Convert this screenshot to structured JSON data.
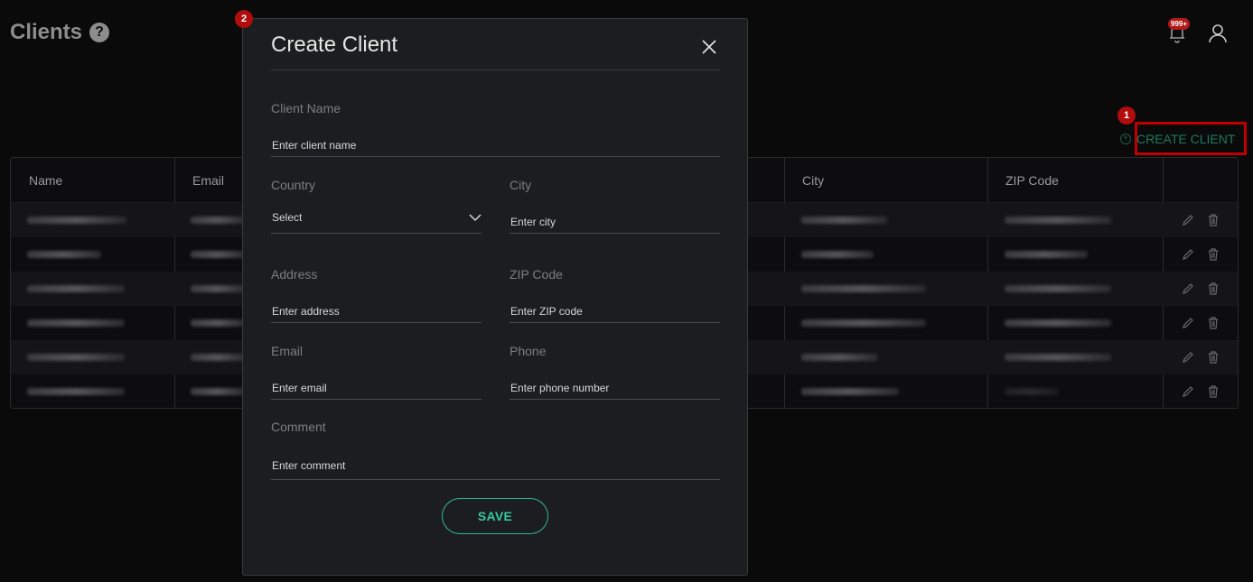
{
  "header": {
    "title": "Clients",
    "help_glyph": "?",
    "notification_count": "999+"
  },
  "toolbar": {
    "create_client_label": "CREATE CLIENT",
    "create_icon": "plus-circle-icon"
  },
  "markers": {
    "first": "1",
    "second": "2"
  },
  "table": {
    "columns": [
      "Name",
      "Email",
      "City",
      "ZIP Code"
    ],
    "row_count": 6
  },
  "modal": {
    "title": "Create Client",
    "fields": {
      "client_name": {
        "label": "Client Name",
        "placeholder": "Enter client name"
      },
      "country": {
        "label": "Country",
        "value": "Select"
      },
      "city": {
        "label": "City",
        "placeholder": "Enter city"
      },
      "address": {
        "label": "Address",
        "placeholder": "Enter address"
      },
      "zip": {
        "label": "ZIP Code",
        "placeholder": "Enter ZIP code"
      },
      "email": {
        "label": "Email",
        "placeholder": "Enter email"
      },
      "phone": {
        "label": "Phone",
        "placeholder": "Enter phone number"
      },
      "comment": {
        "label": "Comment",
        "placeholder": "Enter comment"
      }
    },
    "save_label": "SAVE"
  },
  "colors": {
    "accent": "#35c9a4",
    "highlight": "#c00000",
    "background": "#0a0a0b",
    "modal_bg": "#1c1d20"
  }
}
